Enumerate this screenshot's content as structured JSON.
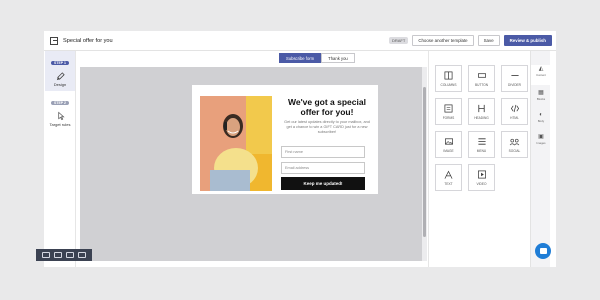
{
  "header": {
    "title": "Special offer for you",
    "status_pill": "DRAFT",
    "choose_template_label": "Choose another template",
    "save_label": "Save",
    "review_publish_label": "Review & publish"
  },
  "steps": [
    {
      "badge": "STEP 1",
      "label": "Design",
      "icon": "brush-icon",
      "active": true
    },
    {
      "badge": "STEP 2",
      "label": "Target rules",
      "icon": "cursor-icon",
      "active": false
    }
  ],
  "tabs": [
    {
      "label": "Subscribe form",
      "active": true
    },
    {
      "label": "Thank you",
      "active": false
    }
  ],
  "popup": {
    "headline": "We've got a special offer for you!",
    "subtext": "Get our latest updates directly to your mailbox, and get a chance to win a GIFT CARD just for a new subscriber!",
    "first_name_placeholder": "First name",
    "email_placeholder": "Email address",
    "cta_label": "Keep me updated!"
  },
  "blocks": [
    {
      "label": "COLUMNS",
      "icon": "columns-icon"
    },
    {
      "label": "BUTTON",
      "icon": "button-icon"
    },
    {
      "label": "DIVIDER",
      "icon": "divider-icon"
    },
    {
      "label": "FORMS",
      "icon": "form-icon"
    },
    {
      "label": "HEADING",
      "icon": "heading-icon"
    },
    {
      "label": "HTML",
      "icon": "code-icon"
    },
    {
      "label": "IMAGE",
      "icon": "image-icon"
    },
    {
      "label": "MENU",
      "icon": "menu-icon"
    },
    {
      "label": "SOCIAL",
      "icon": "social-icon"
    },
    {
      "label": "TEXT",
      "icon": "text-icon"
    },
    {
      "label": "VIDEO",
      "icon": "video-icon"
    }
  ],
  "rail": [
    {
      "label": "Content",
      "icon": "shapes-icon",
      "active": true
    },
    {
      "label": "Blocks",
      "icon": "blocks-icon",
      "active": false
    },
    {
      "label": "Body",
      "icon": "palette-icon",
      "active": false
    },
    {
      "label": "Images",
      "icon": "images-icon",
      "active": false
    }
  ],
  "colors": {
    "accent": "#4b5aa6",
    "canvas_bg": "#d0d0d3",
    "cta_bg": "#111111",
    "chat_button": "#1f7dd6"
  }
}
